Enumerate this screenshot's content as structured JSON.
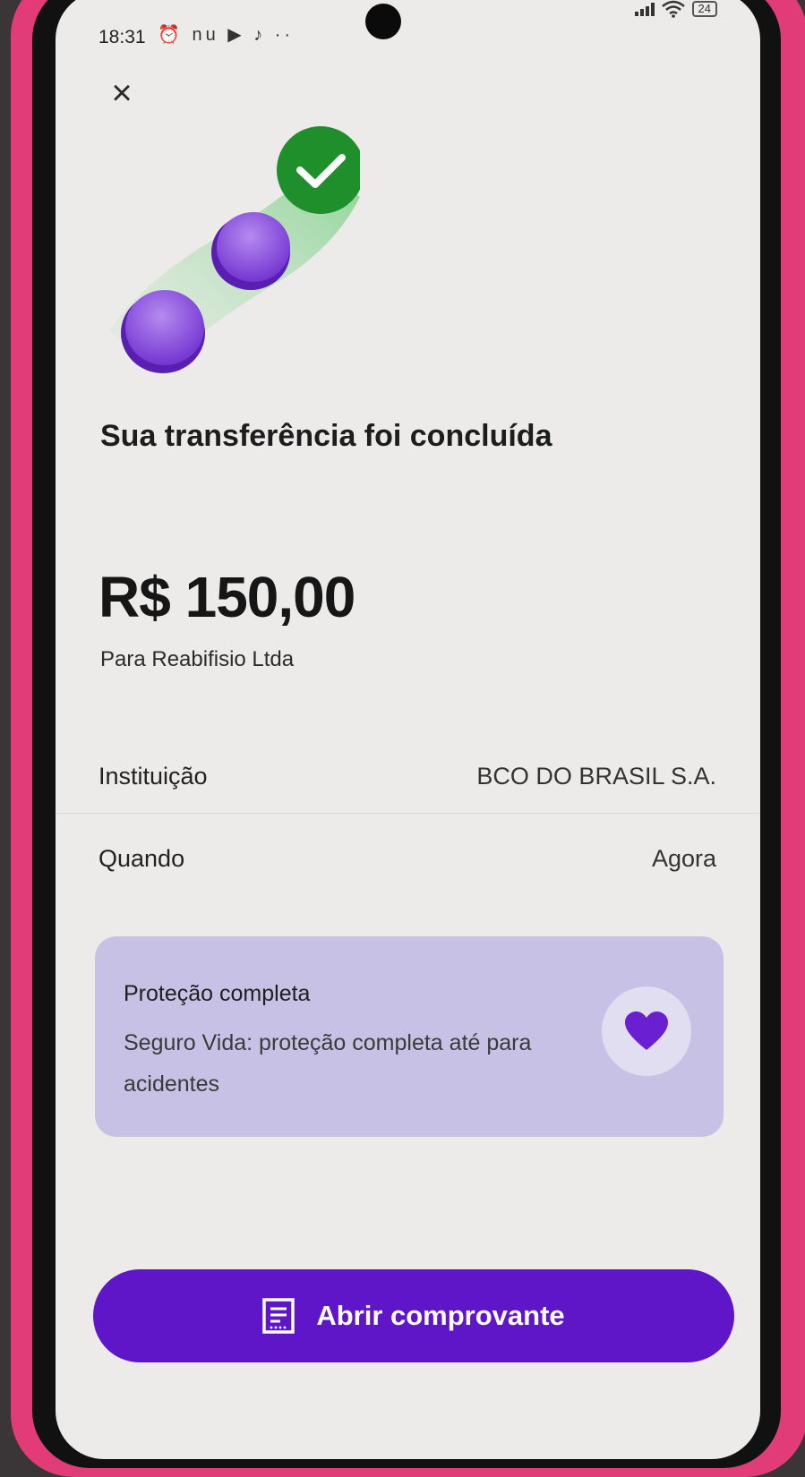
{
  "status_bar": {
    "time": "18:31",
    "notification_icons": "⏰ nu ▶ ♪ ··",
    "battery": "24"
  },
  "header": {
    "close_icon": "close-icon"
  },
  "illustration": {
    "description_icon": "transfer-success-coins-icon",
    "check_color": "#1e8f2b",
    "coin_color": "#7c3ad4"
  },
  "headline": "Sua transferência foi concluída",
  "transfer": {
    "amount": "R$ 150,00",
    "recipient": "Para Reabifisio Ltda"
  },
  "details": [
    {
      "label": "Instituição",
      "value": "BCO DO BRASIL S.A."
    },
    {
      "label": "Quando",
      "value": "Agora"
    }
  ],
  "promo": {
    "title": "Proteção completa",
    "body": "Seguro Vida: proteção completa até para acidentes",
    "icon": "heart-icon",
    "background": "#c7c1e6"
  },
  "cta": {
    "label": "Abrir comprovante",
    "icon": "receipt-icon",
    "color": "#5f16c8"
  }
}
